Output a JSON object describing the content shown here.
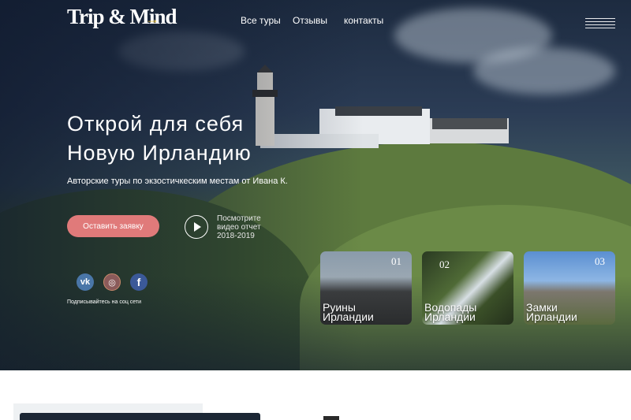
{
  "header": {
    "logo": "Trip & Mind",
    "logo_arrow": "→",
    "nav": [
      {
        "label": "Все туры"
      },
      {
        "label": "Отзывы"
      },
      {
        "label": "контакты"
      }
    ]
  },
  "hero": {
    "headline_line1": "Открой для себя",
    "headline_line2": "Новую Ирландию",
    "subtitle": "Авторские туры по экзостичкеским местам от Ивана К.",
    "cta_label": "Оставить заявку",
    "video_line1": "Посмотрите",
    "video_line2": "видео отчет",
    "video_line3": "2018-2019"
  },
  "social": {
    "caption": "Подписывайтесь на соц сети",
    "items": [
      {
        "icon": "vk-icon",
        "glyph": "vk",
        "color": "#4a76a8"
      },
      {
        "icon": "instagram-icon",
        "glyph": "◎",
        "color": "#8a5a5a"
      },
      {
        "icon": "facebook-icon",
        "glyph": "f",
        "color": "#3b5998"
      }
    ]
  },
  "cards": [
    {
      "num": "01",
      "line1": "Руины",
      "line2": "Ирландии"
    },
    {
      "num": "02",
      "line1": "Водопады",
      "line2": "Ирландии"
    },
    {
      "num": "03",
      "line1": "Замки",
      "line2": "Ирландии"
    }
  ],
  "colors": {
    "accent": "#e07a7a",
    "logo_arrow": "#e8c44a"
  }
}
